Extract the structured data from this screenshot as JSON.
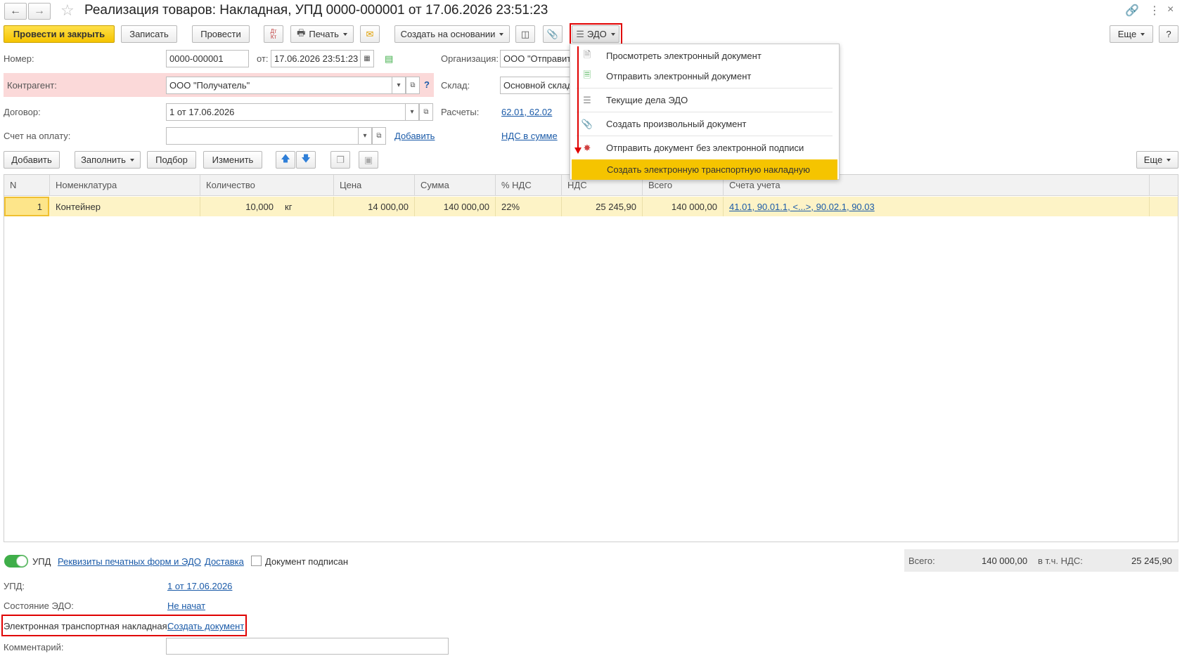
{
  "window": {
    "title": "Реализация товаров: Накладная, УПД 0000-000001 от 17.06.2026 23:51:23"
  },
  "toolbar": {
    "post_close": "Провести и закрыть",
    "save": "Записать",
    "post": "Провести",
    "dt_kt": "Дт Кт",
    "print": "Печать",
    "create_based": "Создать на основании",
    "edo": "ЭДО",
    "more": "Еще",
    "help": "?"
  },
  "form": {
    "number_label": "Номер:",
    "number_value": "0000-000001",
    "from_label": "от:",
    "date_value": "17.06.2026 23:51:23",
    "org_label": "Организация:",
    "org_value": "ООО \"Отправит",
    "counterparty_label": "Контрагент:",
    "counterparty_value": "ООО \"Получатель\"",
    "warehouse_label": "Склад:",
    "warehouse_value": "Основной склад",
    "contract_label": "Договор:",
    "contract_value": "1 от 17.06.2026",
    "settlements_label": "Расчеты:",
    "settlements_link": "62.01, 62.02",
    "invoice_label": "Счет на оплату:",
    "invoice_value": "",
    "add_link": "Добавить",
    "vat_link": "НДС в сумме",
    "help_mark": "?"
  },
  "table_toolbar": {
    "add": "Добавить",
    "fill": "Заполнить",
    "select": "Подбор",
    "change": "Изменить",
    "more": "Еще"
  },
  "table": {
    "headers": [
      "N",
      "Номенклатура",
      "Количество",
      "Цена",
      "Сумма",
      "% НДС",
      "НДС",
      "Всего",
      "Счета учета"
    ],
    "rows": [
      {
        "n": "1",
        "item": "Контейнер",
        "qty": "10,000",
        "unit": "кг",
        "price": "14 000,00",
        "sum": "140 000,00",
        "vat_rate": "22%",
        "vat": "25 245,90",
        "total": "140 000,00",
        "accounts": "41.01, 90.01.1, <...>, 90.02.1, 90.03"
      }
    ]
  },
  "edo_menu": {
    "items": [
      {
        "label": "Просмотреть электронный документ",
        "icon": "document-icon"
      },
      {
        "label": "Отправить электронный документ",
        "icon": "send-document-icon"
      },
      {
        "label": "Текущие дела ЭДО",
        "icon": "edo-tasks-icon"
      },
      {
        "label": "Создать произвольный документ",
        "icon": "paperclip-icon"
      },
      {
        "label": "Отправить документ без электронной подписи",
        "icon": "unsigned-send-icon"
      },
      {
        "label": "Создать электронную транспортную накладную",
        "icon": ""
      }
    ],
    "highlight_color": "#f5c400"
  },
  "footer": {
    "upd_toggle_label": "УПД",
    "print_forms_link": "Реквизиты печатных форм и ЭДО",
    "delivery_link": "Доставка",
    "signed_label": "Документ подписан",
    "upd_label": "УПД:",
    "upd_link": "1 от 17.06.2026",
    "edo_state_label": "Состояние ЭДО:",
    "edo_state_link": "Не начат",
    "etn_label": "Электронная транспортная накладная:",
    "etn_link": "Создать документ",
    "comment_label": "Комментарий:",
    "comment_value": "",
    "total_label": "Всего:",
    "total_value": "140 000,00",
    "incl_vat_label": "в т.ч. НДС:",
    "incl_vat_value": "25 245,90"
  },
  "colors": {
    "accent_yellow": "#f5c400",
    "highlight_red": "#e00000",
    "link_blue": "#1a5aa8",
    "row_highlight": "#fdf3c6",
    "counterparty_bg": "#fbd9d9",
    "toggle_green": "#3fae49"
  }
}
